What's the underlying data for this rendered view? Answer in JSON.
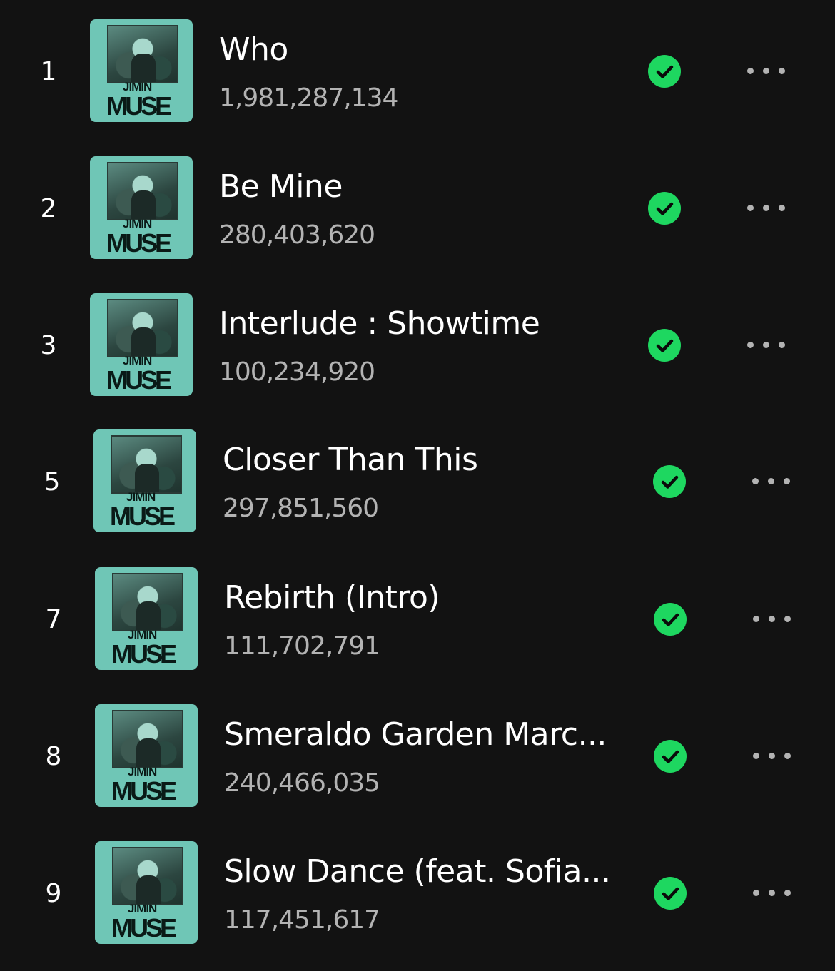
{
  "tracks": [
    {
      "number": "1",
      "title": "Who",
      "plays": "1,981,287,134",
      "saved": true,
      "cover_top_text": "JIMIN",
      "cover_bottom_text": "MUSE"
    },
    {
      "number": "2",
      "title": "Be Mine",
      "plays": "280,403,620",
      "saved": true,
      "cover_top_text": "JIMIN",
      "cover_bottom_text": "MUSE"
    },
    {
      "number": "3",
      "title": "Interlude : Showtime",
      "plays": "100,234,920",
      "saved": true,
      "cover_top_text": "JIMIN",
      "cover_bottom_text": "MUSE"
    },
    {
      "number": "5",
      "title": "Closer Than This",
      "plays": "297,851,560",
      "saved": true,
      "cover_top_text": "JIMIN",
      "cover_bottom_text": "MUSE"
    },
    {
      "number": "7",
      "title": "Rebirth (Intro)",
      "plays": "111,702,791",
      "saved": true,
      "cover_top_text": "JIMIN",
      "cover_bottom_text": "MUSE"
    },
    {
      "number": "8",
      "title": "Smeraldo Garden Marc...",
      "plays": "240,466,035",
      "saved": true,
      "cover_top_text": "JIMIN",
      "cover_bottom_text": "MUSE"
    },
    {
      "number": "9",
      "title": "Slow Dance (feat. Sofia...",
      "plays": "117,451,617",
      "saved": true,
      "cover_top_text": "JIMIN",
      "cover_bottom_text": "MUSE"
    }
  ],
  "colors": {
    "background": "#121212",
    "saved_green": "#1ed760",
    "cover_teal": "#6fc6b6",
    "secondary_text": "#b3b3b3"
  },
  "icons": {
    "saved": "check-circle-icon",
    "more": "more-options-icon"
  }
}
